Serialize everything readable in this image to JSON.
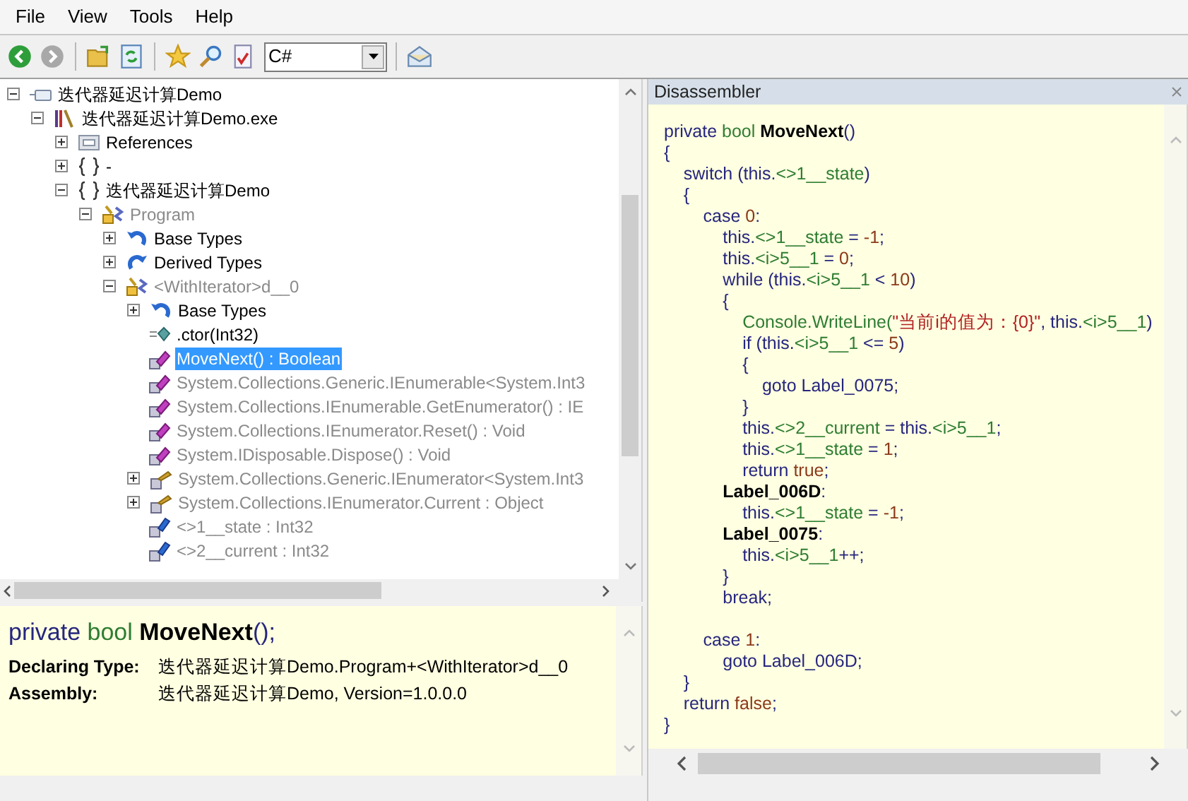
{
  "menu": [
    {
      "label": "File"
    },
    {
      "label": "View"
    },
    {
      "label": "Tools"
    },
    {
      "label": "Help"
    }
  ],
  "toolbar": [
    {
      "kind": "back",
      "disabled": false
    },
    {
      "kind": "forward",
      "disabled": true
    },
    {
      "kind": "separator"
    },
    {
      "kind": "open"
    },
    {
      "kind": "refresh"
    },
    {
      "kind": "separator"
    },
    {
      "kind": "bookmark"
    },
    {
      "kind": "search"
    },
    {
      "kind": "analyze"
    },
    {
      "kind": "language",
      "value": "C#"
    },
    {
      "kind": "separator"
    },
    {
      "kind": "mail"
    }
  ],
  "tree": [
    {
      "label": "迭代器延迟计算Demo",
      "kind": "module",
      "expanded": true,
      "greyed": false,
      "selected": false,
      "children": [
        {
          "label": "迭代器延迟计算Demo.exe",
          "kind": "library",
          "expanded": true,
          "greyed": false,
          "selected": false,
          "children": [
            {
              "label": "References",
              "kind": "references",
              "expanded": false,
              "greyed": false,
              "selected": false
            },
            {
              "label": "-",
              "kind": "namespace",
              "expanded": false,
              "greyed": false,
              "selected": false
            },
            {
              "label": "迭代器延迟计算Demo",
              "kind": "namespace",
              "expanded": true,
              "greyed": false,
              "selected": false,
              "children": [
                {
                  "label": "Program",
                  "kind": "class",
                  "expanded": true,
                  "greyed": true,
                  "selected": false,
                  "children": [
                    {
                      "label": "Base Types",
                      "kind": "base-types",
                      "expanded": false,
                      "greyed": false,
                      "selected": false
                    },
                    {
                      "label": "Derived Types",
                      "kind": "derived-types",
                      "expanded": false,
                      "greyed": false,
                      "selected": false
                    },
                    {
                      "label": "<WithIterator>d__0",
                      "kind": "class",
                      "expanded": true,
                      "greyed": true,
                      "selected": false,
                      "children": [
                        {
                          "label": "Base Types",
                          "kind": "base-types",
                          "expanded": false,
                          "greyed": false,
                          "selected": false
                        },
                        {
                          "label": ".ctor(Int32)",
                          "kind": "constructor",
                          "greyed": false,
                          "selected": false
                        },
                        {
                          "label": "MoveNext() : Boolean",
                          "kind": "method",
                          "selected": true
                        },
                        {
                          "label": "System.Collections.Generic.IEnumerable<System.Int3",
                          "kind": "method",
                          "greyed": true,
                          "selected": false
                        },
                        {
                          "label": "System.Collections.IEnumerable.GetEnumerator() : IE",
                          "kind": "method",
                          "greyed": true,
                          "selected": false
                        },
                        {
                          "label": "System.Collections.IEnumerator.Reset() : Void",
                          "kind": "method",
                          "greyed": true,
                          "selected": false
                        },
                        {
                          "label": "System.IDisposable.Dispose() : Void",
                          "kind": "method",
                          "greyed": true,
                          "selected": false
                        },
                        {
                          "label": "System.Collections.Generic.IEnumerator<System.Int3",
                          "kind": "property",
                          "expanded": false,
                          "greyed": true,
                          "selected": false
                        },
                        {
                          "label": "System.Collections.IEnumerator.Current : Object",
                          "kind": "property",
                          "expanded": false,
                          "greyed": true,
                          "selected": false
                        },
                        {
                          "label": "<>1__state : Int32",
                          "kind": "field",
                          "greyed": true,
                          "selected": false
                        },
                        {
                          "label": "<>2__current : Int32",
                          "kind": "field",
                          "greyed": true,
                          "selected": false
                        }
                      ]
                    }
                  ]
                }
              ]
            }
          ]
        }
      ]
    }
  ],
  "info": {
    "signature": [
      {
        "kind": "keyword",
        "text": "private "
      },
      {
        "kind": "type",
        "text": "bool "
      },
      {
        "kind": "name",
        "text": "MoveNext"
      },
      {
        "kind": "plain",
        "text": "();"
      }
    ],
    "fields": [
      {
        "label": "Declaring Type:",
        "value": "迭代器延迟计算Demo.Program+<WithIterator>d__0"
      },
      {
        "label": "Assembly:",
        "value": "迭代器延迟计算Demo, Version=1.0.0.0"
      }
    ]
  },
  "disassembler": {
    "title": "Disassembler",
    "lines": [
      {
        "tokens": [
          {
            "kind": "keyword",
            "text": "private "
          },
          {
            "kind": "type",
            "text": "bool "
          },
          {
            "kind": "name",
            "text": "MoveNext"
          },
          {
            "kind": "plain",
            "text": "()"
          }
        ]
      },
      {
        "tokens": [
          {
            "kind": "plain",
            "text": "{"
          }
        ]
      },
      {
        "tokens": [
          {
            "kind": "plain",
            "text": "    switch (this."
          },
          {
            "kind": "member",
            "text": "<>1__state"
          },
          {
            "kind": "plain",
            "text": ")"
          }
        ]
      },
      {
        "tokens": [
          {
            "kind": "plain",
            "text": "    {"
          }
        ]
      },
      {
        "tokens": [
          {
            "kind": "plain",
            "text": "        case "
          },
          {
            "kind": "number",
            "text": "0"
          },
          {
            "kind": "plain",
            "text": ":"
          }
        ]
      },
      {
        "tokens": [
          {
            "kind": "plain",
            "text": "            this."
          },
          {
            "kind": "member",
            "text": "<>1__state"
          },
          {
            "kind": "plain",
            "text": " = "
          },
          {
            "kind": "number",
            "text": "-1"
          },
          {
            "kind": "plain",
            "text": ";"
          }
        ]
      },
      {
        "tokens": [
          {
            "kind": "plain",
            "text": "            this."
          },
          {
            "kind": "member",
            "text": "<i>5__1"
          },
          {
            "kind": "plain",
            "text": " = "
          },
          {
            "kind": "number",
            "text": "0"
          },
          {
            "kind": "plain",
            "text": ";"
          }
        ]
      },
      {
        "tokens": [
          {
            "kind": "plain",
            "text": "            while (this."
          },
          {
            "kind": "member",
            "text": "<i>5__1"
          },
          {
            "kind": "plain",
            "text": " < "
          },
          {
            "kind": "number",
            "text": "10"
          },
          {
            "kind": "plain",
            "text": ")"
          }
        ]
      },
      {
        "tokens": [
          {
            "kind": "plain",
            "text": "            {"
          }
        ]
      },
      {
        "tokens": [
          {
            "kind": "member",
            "text": "                Console.WriteLine("
          },
          {
            "kind": "string",
            "text": "\"当前i的值为：{0}\""
          },
          {
            "kind": "plain",
            "text": ", this."
          },
          {
            "kind": "member",
            "text": "<i>5__1"
          },
          {
            "kind": "plain",
            "text": ")"
          }
        ]
      },
      {
        "tokens": [
          {
            "kind": "plain",
            "text": "                if (this."
          },
          {
            "kind": "member",
            "text": "<i>5__1"
          },
          {
            "kind": "plain",
            "text": " <= "
          },
          {
            "kind": "number",
            "text": "5"
          },
          {
            "kind": "plain",
            "text": ")"
          }
        ]
      },
      {
        "tokens": [
          {
            "kind": "plain",
            "text": "                {"
          }
        ]
      },
      {
        "tokens": [
          {
            "kind": "plain",
            "text": "                    goto Label_0075;"
          }
        ]
      },
      {
        "tokens": [
          {
            "kind": "plain",
            "text": "                }"
          }
        ]
      },
      {
        "tokens": [
          {
            "kind": "plain",
            "text": "                this."
          },
          {
            "kind": "member",
            "text": "<>2__current"
          },
          {
            "kind": "plain",
            "text": " = this."
          },
          {
            "kind": "member",
            "text": "<i>5__1"
          },
          {
            "kind": "plain",
            "text": ";"
          }
        ]
      },
      {
        "tokens": [
          {
            "kind": "plain",
            "text": "                this."
          },
          {
            "kind": "member",
            "text": "<>1__state"
          },
          {
            "kind": "plain",
            "text": " = "
          },
          {
            "kind": "number",
            "text": "1"
          },
          {
            "kind": "plain",
            "text": ";"
          }
        ]
      },
      {
        "tokens": [
          {
            "kind": "plain",
            "text": "                return "
          },
          {
            "kind": "number",
            "text": "true"
          },
          {
            "kind": "plain",
            "text": ";"
          }
        ]
      },
      {
        "tokens": [
          {
            "kind": "label",
            "text": "            Label_006D"
          },
          {
            "kind": "plain",
            "text": ":"
          }
        ]
      },
      {
        "tokens": [
          {
            "kind": "plain",
            "text": "                this."
          },
          {
            "kind": "member",
            "text": "<>1__state"
          },
          {
            "kind": "plain",
            "text": " = "
          },
          {
            "kind": "number",
            "text": "-1"
          },
          {
            "kind": "plain",
            "text": ";"
          }
        ]
      },
      {
        "tokens": [
          {
            "kind": "label",
            "text": "            Label_0075"
          },
          {
            "kind": "plain",
            "text": ":"
          }
        ]
      },
      {
        "tokens": [
          {
            "kind": "plain",
            "text": "                this."
          },
          {
            "kind": "member",
            "text": "<i>5__1"
          },
          {
            "kind": "plain",
            "text": "++;"
          }
        ]
      },
      {
        "tokens": [
          {
            "kind": "plain",
            "text": "            }"
          }
        ]
      },
      {
        "tokens": [
          {
            "kind": "plain",
            "text": "            break;"
          }
        ]
      },
      {
        "gap_before": true,
        "tokens": [
          {
            "kind": "plain",
            "text": "        case "
          },
          {
            "kind": "number",
            "text": "1"
          },
          {
            "kind": "plain",
            "text": ":"
          }
        ]
      },
      {
        "tokens": [
          {
            "kind": "plain",
            "text": "            goto Label_006D;"
          }
        ]
      },
      {
        "tokens": [
          {
            "kind": "plain",
            "text": "    }"
          }
        ]
      },
      {
        "tokens": [
          {
            "kind": "plain",
            "text": "    return "
          },
          {
            "kind": "number",
            "text": "false"
          },
          {
            "kind": "plain",
            "text": ";"
          }
        ]
      },
      {
        "tokens": [
          {
            "kind": "plain",
            "text": "}"
          }
        ]
      }
    ]
  }
}
